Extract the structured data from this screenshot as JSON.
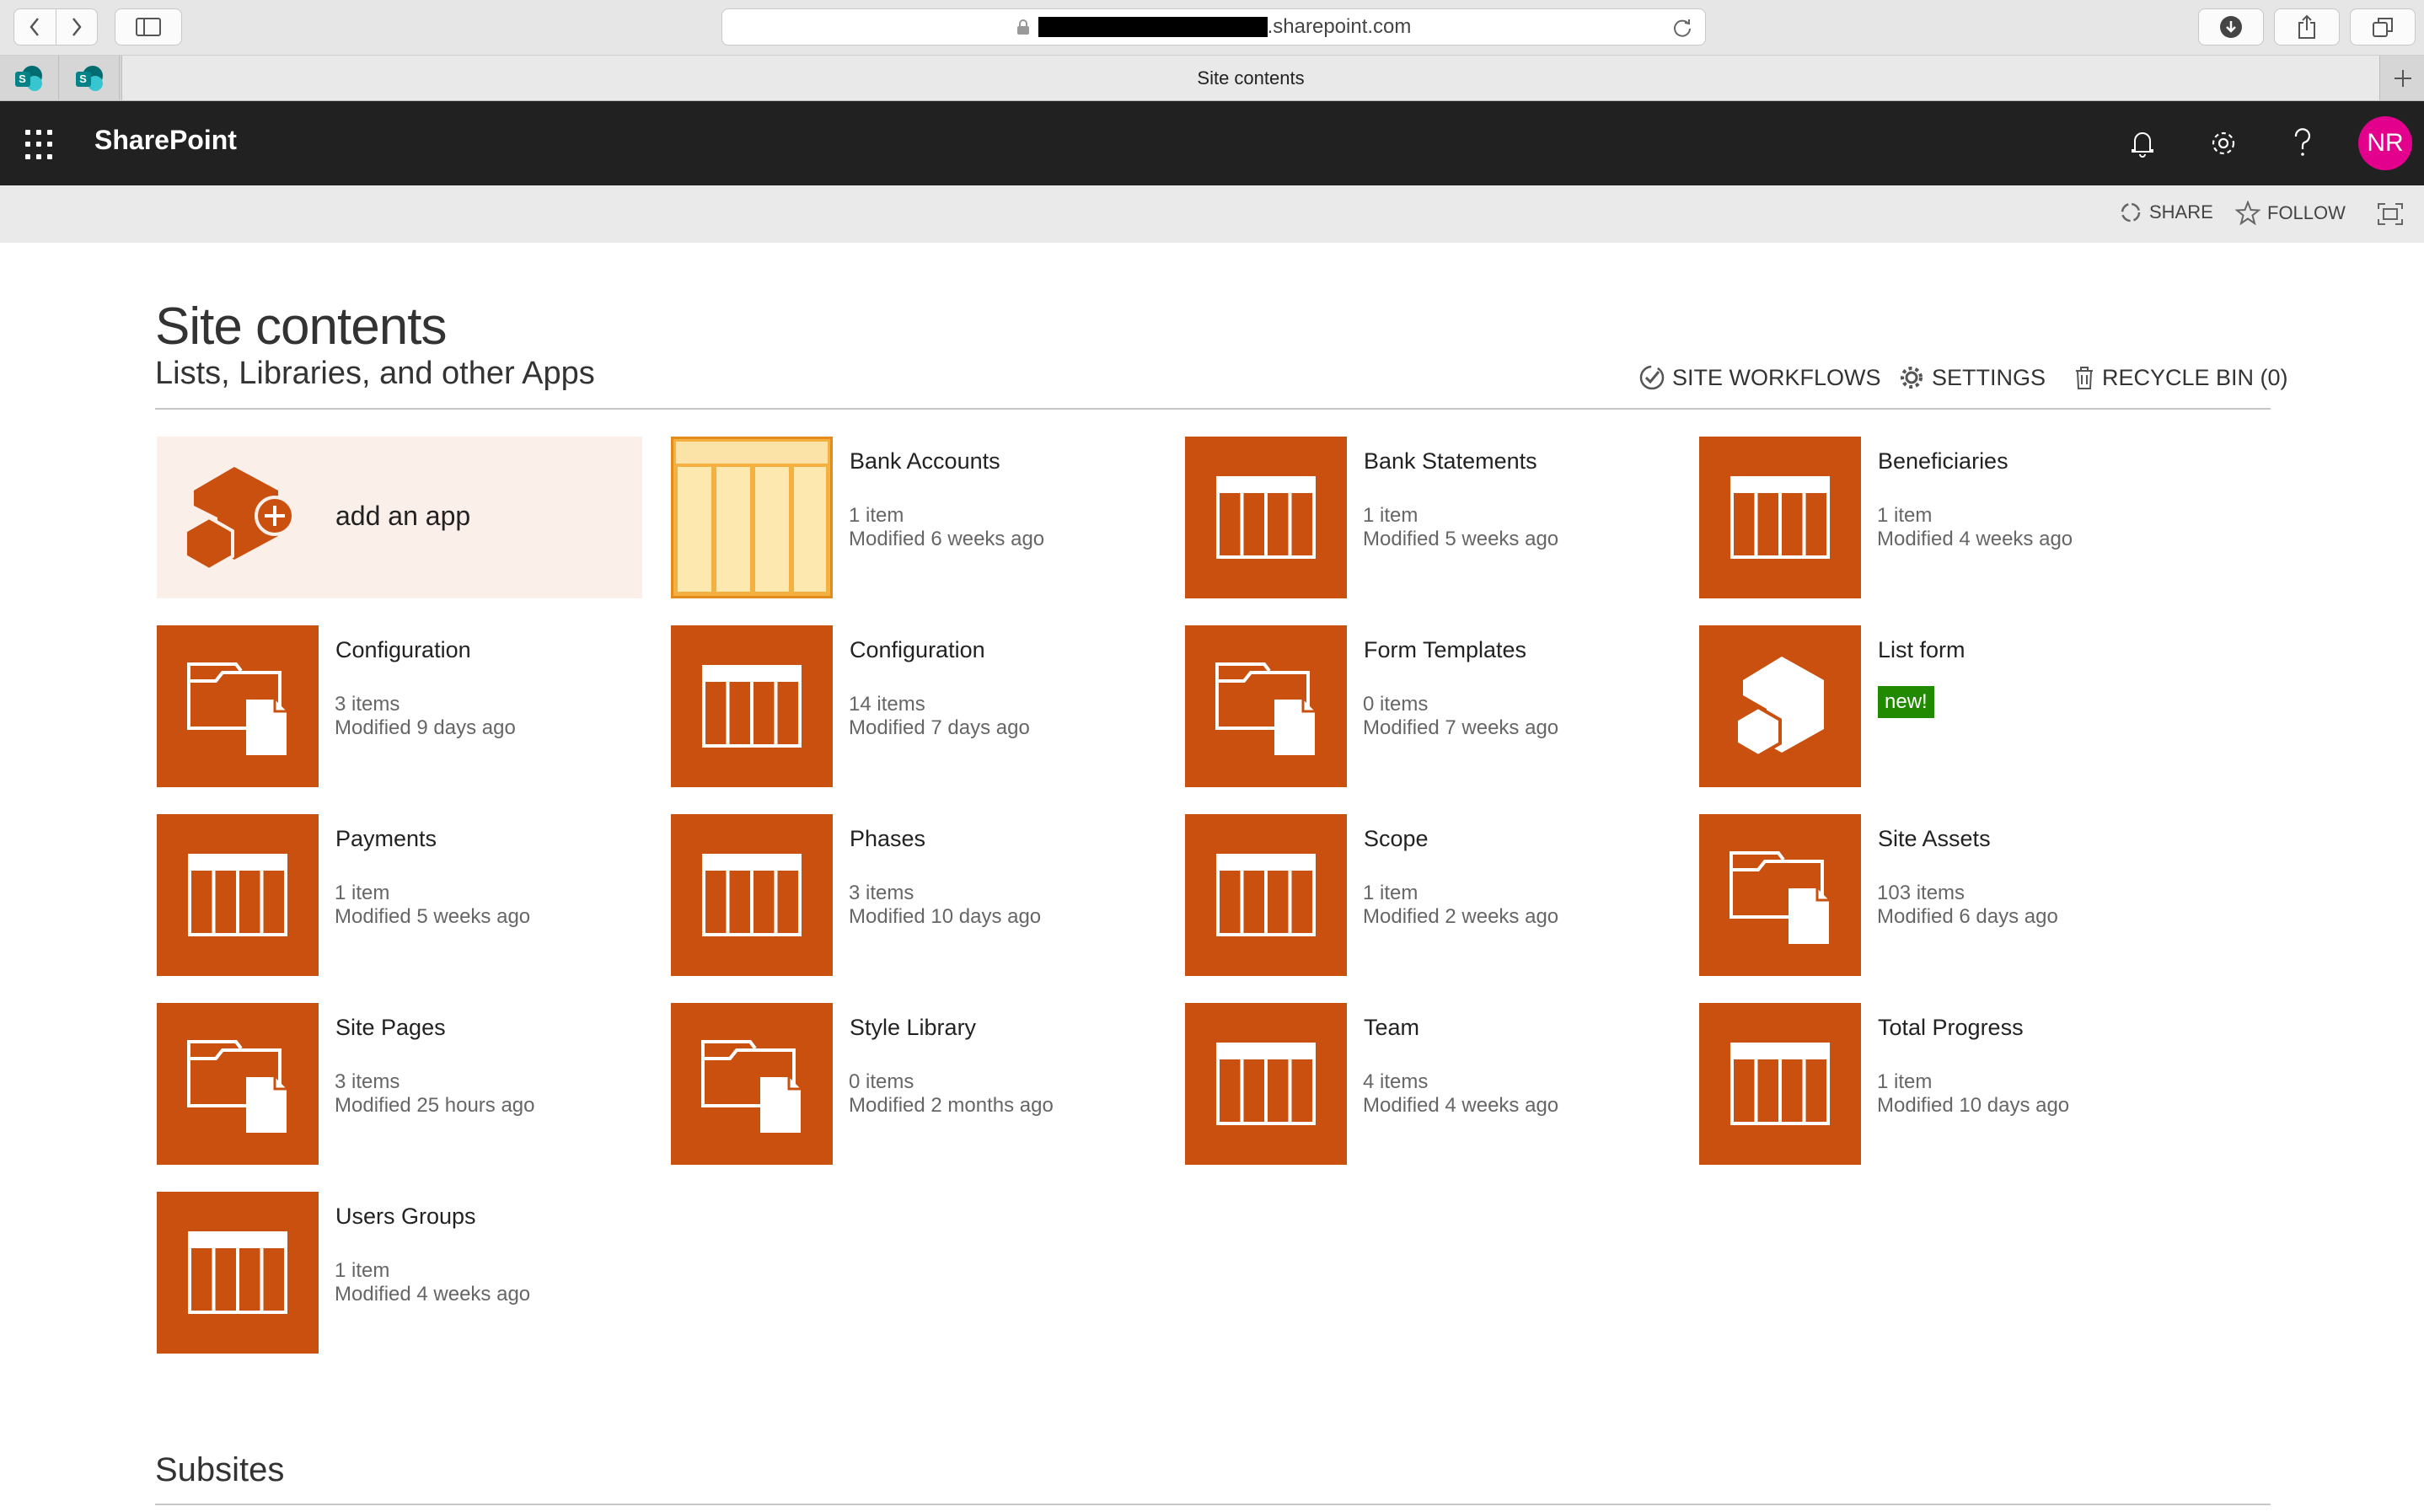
{
  "browser": {
    "url_suffix": ".sharepoint.com",
    "tab_title": "Site contents"
  },
  "suite": {
    "brand": "SharePoint",
    "user_initials": "NR",
    "avatar_color": "#e3008c",
    "icons": [
      "app-launcher-icon",
      "bell-icon",
      "gear-icon",
      "help-icon"
    ]
  },
  "actions": {
    "share": "SHARE",
    "follow": "FOLLOW"
  },
  "page": {
    "title": "Site contents",
    "subtitle": "Lists, Libraries, and other Apps",
    "site_workflows": "SITE WORKFLOWS",
    "settings": "SETTINGS",
    "recycle_bin": "RECYCLE BIN (0)",
    "add_app": "add an app",
    "subsites": "Subsites",
    "accent_color": "#ca5010"
  },
  "tiles": [
    {
      "name": "Bank Accounts",
      "count": "1 item",
      "modified": "Modified 6 weeks ago",
      "icon": "excel-table-icon"
    },
    {
      "name": "Bank Statements",
      "count": "1 item",
      "modified": "Modified 5 weeks ago",
      "icon": "list-icon"
    },
    {
      "name": "Beneficiaries",
      "count": "1 item",
      "modified": "Modified 4 weeks ago",
      "icon": "list-icon"
    },
    {
      "name": "Configuration",
      "count": "3 items",
      "modified": "Modified 9 days ago",
      "icon": "library-icon"
    },
    {
      "name": "Configuration",
      "count": "14 items",
      "modified": "Modified 7 days ago",
      "icon": "list-icon"
    },
    {
      "name": "Form Templates",
      "count": "0 items",
      "modified": "Modified 7 weeks ago",
      "icon": "library-icon"
    },
    {
      "name": "List form",
      "badge": "new!",
      "icon": "app-icon"
    },
    {
      "name": "Payments",
      "count": "1 item",
      "modified": "Modified 5 weeks ago",
      "icon": "list-icon"
    },
    {
      "name": "Phases",
      "count": "3 items",
      "modified": "Modified 10 days ago",
      "icon": "list-icon"
    },
    {
      "name": "Scope",
      "count": "1 item",
      "modified": "Modified 2 weeks ago",
      "icon": "list-icon"
    },
    {
      "name": "Site Assets",
      "count": "103 items",
      "modified": "Modified 6 days ago",
      "icon": "library-icon"
    },
    {
      "name": "Site Pages",
      "count": "3 items",
      "modified": "Modified 25 hours ago",
      "icon": "library-icon"
    },
    {
      "name": "Style Library",
      "count": "0 items",
      "modified": "Modified 2 months ago",
      "icon": "library-icon"
    },
    {
      "name": "Team",
      "count": "4 items",
      "modified": "Modified 4 weeks ago",
      "icon": "list-icon"
    },
    {
      "name": "Total Progress",
      "count": "1 item",
      "modified": "Modified 10 days ago",
      "icon": "list-icon"
    },
    {
      "name": "Users Groups",
      "count": "1 item",
      "modified": "Modified 4 weeks ago",
      "icon": "list-icon"
    }
  ]
}
